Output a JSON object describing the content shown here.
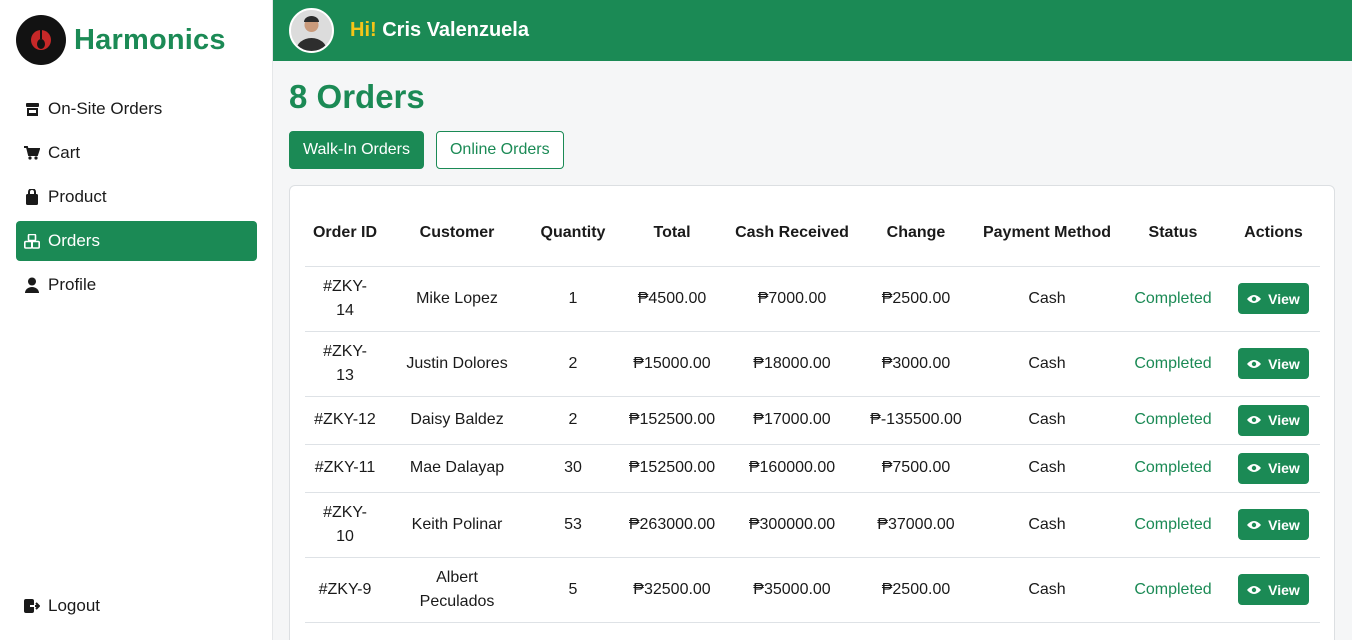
{
  "brand": {
    "name": "Harmonics",
    "logo_icon": "guitar-icon"
  },
  "sidebar": {
    "items": [
      {
        "label": "On-Site Orders",
        "icon": "store-icon"
      },
      {
        "label": "Cart",
        "icon": "cart-icon"
      },
      {
        "label": "Product",
        "icon": "bag-icon"
      },
      {
        "label": "Orders",
        "icon": "boxes-icon",
        "active": true
      },
      {
        "label": "Profile",
        "icon": "user-icon"
      }
    ],
    "logout_label": "Logout"
  },
  "header": {
    "hi": "Hi!",
    "user_name": "Cris Valenzuela"
  },
  "page": {
    "title": "8 Orders"
  },
  "tabs": [
    {
      "label": "Walk-In Orders",
      "active": true
    },
    {
      "label": "Online Orders",
      "active": false
    }
  ],
  "table": {
    "headers": [
      "Order ID",
      "Customer",
      "Quantity",
      "Total",
      "Cash Received",
      "Change",
      "Payment Method",
      "Status",
      "Actions"
    ],
    "view_label": "View",
    "rows": [
      {
        "id": "#ZKY-14",
        "customer": "Mike Lopez",
        "qty": "1",
        "total": "₱4500.00",
        "cash": "₱7000.00",
        "change": "₱2500.00",
        "method": "Cash",
        "status": "Completed"
      },
      {
        "id": "#ZKY-13",
        "customer": "Justin Dolores",
        "qty": "2",
        "total": "₱15000.00",
        "cash": "₱18000.00",
        "change": "₱3000.00",
        "method": "Cash",
        "status": "Completed"
      },
      {
        "id": "#ZKY-12",
        "customer": "Daisy Baldez",
        "qty": "2",
        "total": "₱152500.00",
        "cash": "₱17000.00",
        "change": "₱-135500.00",
        "method": "Cash",
        "status": "Completed"
      },
      {
        "id": "#ZKY-11",
        "customer": "Mae Dalayap",
        "qty": "30",
        "total": "₱152500.00",
        "cash": "₱160000.00",
        "change": "₱7500.00",
        "method": "Cash",
        "status": "Completed"
      },
      {
        "id": "#ZKY-10",
        "customer": "Keith Polinar",
        "qty": "53",
        "total": "₱263000.00",
        "cash": "₱300000.00",
        "change": "₱37000.00",
        "method": "Cash",
        "status": "Completed"
      },
      {
        "id": "#ZKY-9",
        "customer": "Albert Peculados",
        "qty": "5",
        "total": "₱32500.00",
        "cash": "₱35000.00",
        "change": "₱2500.00",
        "method": "Cash",
        "status": "Completed"
      }
    ]
  },
  "colors": {
    "primary": "#1b8a55",
    "accent": "#f5c518"
  }
}
